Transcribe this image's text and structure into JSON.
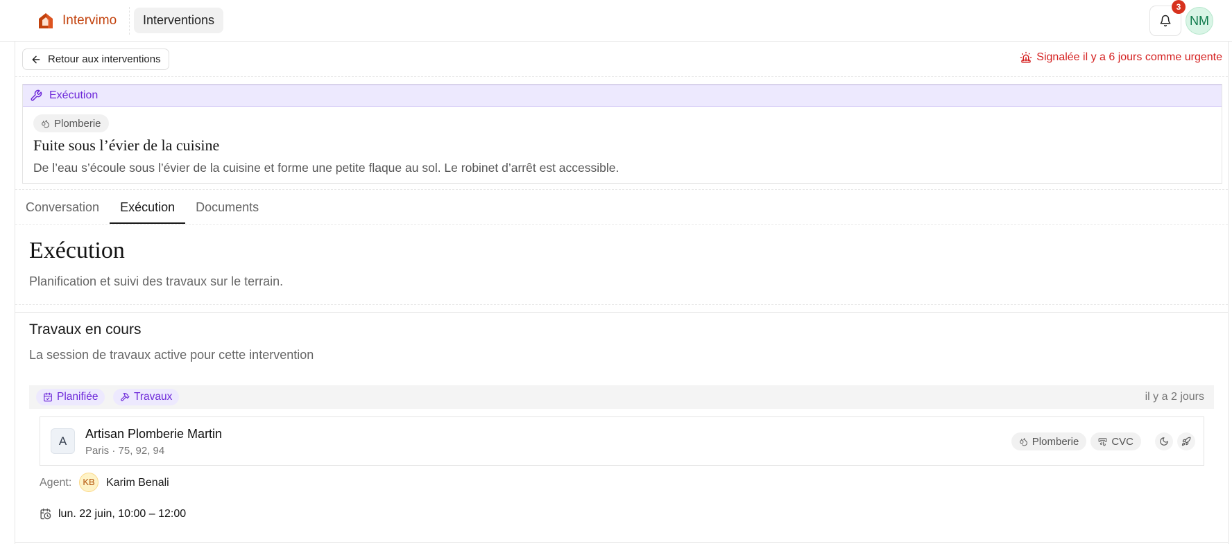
{
  "header": {
    "brand": "Intervimo",
    "nav_active": "Interventions",
    "notifications_count": "3",
    "user_initials": "NM"
  },
  "back_label": "Retour aux interventions",
  "urgent_label": "Signalée il y a 6 jours comme urgente",
  "intervention": {
    "status": "Exécution",
    "category": "Plomberie",
    "title": "Fuite sous l’évier de la cuisine",
    "description": "De l’eau s’écoule sous l’évier de la cuisine et forme une petite flaque au sol. Le robinet d’arrêt est accessible."
  },
  "tabs": [
    {
      "label": "Conversation",
      "active": false
    },
    {
      "label": "Exécution",
      "active": true
    },
    {
      "label": "Documents",
      "active": false
    }
  ],
  "section": {
    "title": "Exécution",
    "subtitle": "Planification et suivi des travaux sur le terrain."
  },
  "works": {
    "title": "Travaux en cours",
    "subtitle": "La session de travaux active pour cette intervention",
    "status_chip": "Planifiée",
    "type_chip": "Travaux",
    "time_ago": "il y a 2 jours",
    "provider": {
      "initial": "A",
      "name": "Artisan Plomberie Martin",
      "location": "Paris · 75, 92, 94",
      "tags": [
        "Plomberie",
        "CVC"
      ]
    },
    "agent_label": "Agent:",
    "agent_initials": "KB",
    "agent_name": "Karim Benali",
    "schedule": "lun. 22 juin, 10:00 – 12:00"
  },
  "colors": {
    "brand": "#c2410c",
    "accent_purple": "#6d28d9",
    "urgent_red": "#d41f1f",
    "badge_red": "#d7321e"
  }
}
